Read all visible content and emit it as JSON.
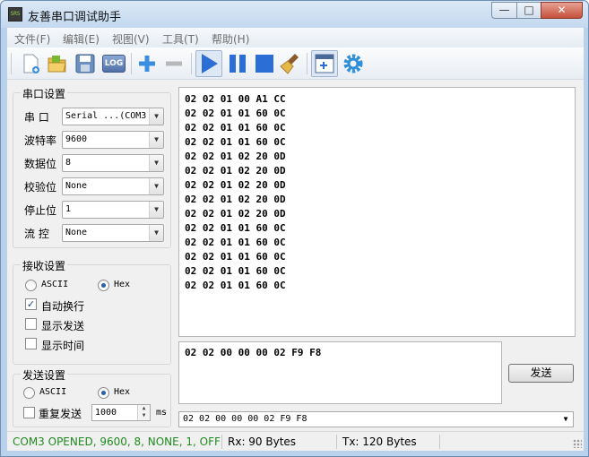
{
  "window": {
    "title": "友善串口调试助手",
    "app_icon_text": "SRS"
  },
  "menu": [
    "文件(F)",
    "编辑(E)",
    "视图(V)",
    "工具(T)",
    "帮助(H)"
  ],
  "toolbar": {
    "log_label": "LOG",
    "icons": [
      "new-icon",
      "open-folder-icon",
      "save-icon",
      "log-icon",
      "add-icon",
      "remove-icon",
      "play-icon",
      "pause-icon",
      "stop-icon",
      "clear-broom-icon",
      "new-window-icon",
      "settings-gear-icon"
    ]
  },
  "serial_settings": {
    "title": "串口设置",
    "port_label": "串 口",
    "port_value": "Serial ...(COM3",
    "baud_label": "波特率",
    "baud_value": "9600",
    "databits_label": "数据位",
    "databits_value": "8",
    "parity_label": "校验位",
    "parity_value": "None",
    "stopbits_label": "停止位",
    "stopbits_value": "1",
    "flow_label": "流 控",
    "flow_value": "None"
  },
  "recv_settings": {
    "title": "接收设置",
    "ascii_label": "ASCII",
    "hex_label": "Hex",
    "selected": "Hex",
    "auto_wrap_label": "自动换行",
    "auto_wrap_checked": true,
    "show_send_label": "显示发送",
    "show_send_checked": false,
    "show_time_label": "显示时间",
    "show_time_checked": false
  },
  "send_settings": {
    "title": "发送设置",
    "ascii_label": "ASCII",
    "hex_label": "Hex",
    "selected": "Hex",
    "repeat_label": "重复发送",
    "repeat_checked": false,
    "interval_value": "1000",
    "interval_unit": "ms"
  },
  "receive_lines": [
    "02 02 01 00 A1 CC",
    "02 02 01 01 60 0C",
    "02 02 01 01 60 0C",
    "02 02 01 01 60 0C",
    "02 02 01 02 20 0D",
    "02 02 01 02 20 0D",
    "02 02 01 02 20 0D",
    "02 02 01 02 20 0D",
    "02 02 01 02 20 0D",
    "02 02 01 01 60 0C",
    "02 02 01 01 60 0C",
    "02 02 01 01 60 0C",
    "02 02 01 01 60 0C",
    "02 02 01 01 60 0C"
  ],
  "send_text": "02 02 00 00 00 02 F9 F8",
  "send_button_label": "发送",
  "history_value": "02 02 00 00 00 02 F9 F8",
  "status": {
    "connection": "COM3 OPENED, 9600, 8, NONE, 1, OFF",
    "connection_color": "#1f8a1f",
    "rx": "Rx: 90 Bytes",
    "tx": "Tx: 120 Bytes"
  }
}
